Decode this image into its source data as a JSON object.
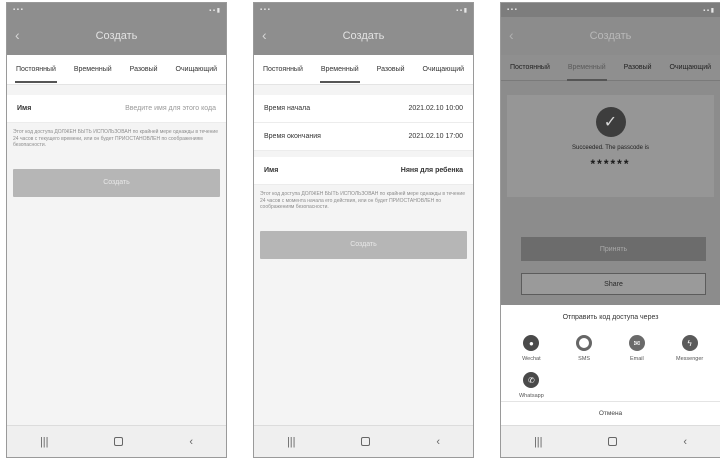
{
  "screens": [
    {
      "title": "Создать",
      "tabs": [
        "Постоянный",
        "Временный",
        "Разовый",
        "Очищающий"
      ],
      "fields": [
        {
          "label": "Имя",
          "placeholder": "Введите имя для этого кода"
        }
      ],
      "note": "Этот код доступа ДОЛЖЕН БЫТЬ ИСПОЛЬЗОВАН по крайней мере однажды в течение 24 часов с текущего времени, или он будет ПРИОСТАНОВЛЕН по соображениям безопасности.",
      "button": "Создать"
    },
    {
      "title": "Создать",
      "tabs": [
        "Постоянный",
        "Временный",
        "Разовый",
        "Очищающий"
      ],
      "fields": [
        {
          "label": "Время начала",
          "value": "2021.02.10 10:00"
        },
        {
          "label": "Время окончания",
          "value": "2021.02.10 17:00"
        },
        {
          "label": "Имя",
          "value": "Няня для ребенка"
        }
      ],
      "note": "Этот код доступа ДОЛЖЕН БЫТЬ ИСПОЛЬЗОВАН по крайней мере однажды в течение 24 часов с момента начала его действия, или он будет ПРИОСТАНОВЛЕН по соображениям безопасности.",
      "button": "Создать"
    },
    {
      "title": "Создать",
      "tabs": [
        "Постоянный",
        "Временный",
        "Разовый",
        "Очищающий"
      ],
      "success_text": "Succeeded. The passcode is",
      "passcode": "******",
      "primary_button": "Принять",
      "share_button": "Share",
      "sheet_title": "Отправить код доступа через",
      "share_options": [
        "Wechat",
        "SMS",
        "Email",
        "Messenger",
        "Whatsapp"
      ],
      "cancel": "Отмена"
    }
  ],
  "nav": {
    "recent": "|||",
    "back": "‹"
  }
}
